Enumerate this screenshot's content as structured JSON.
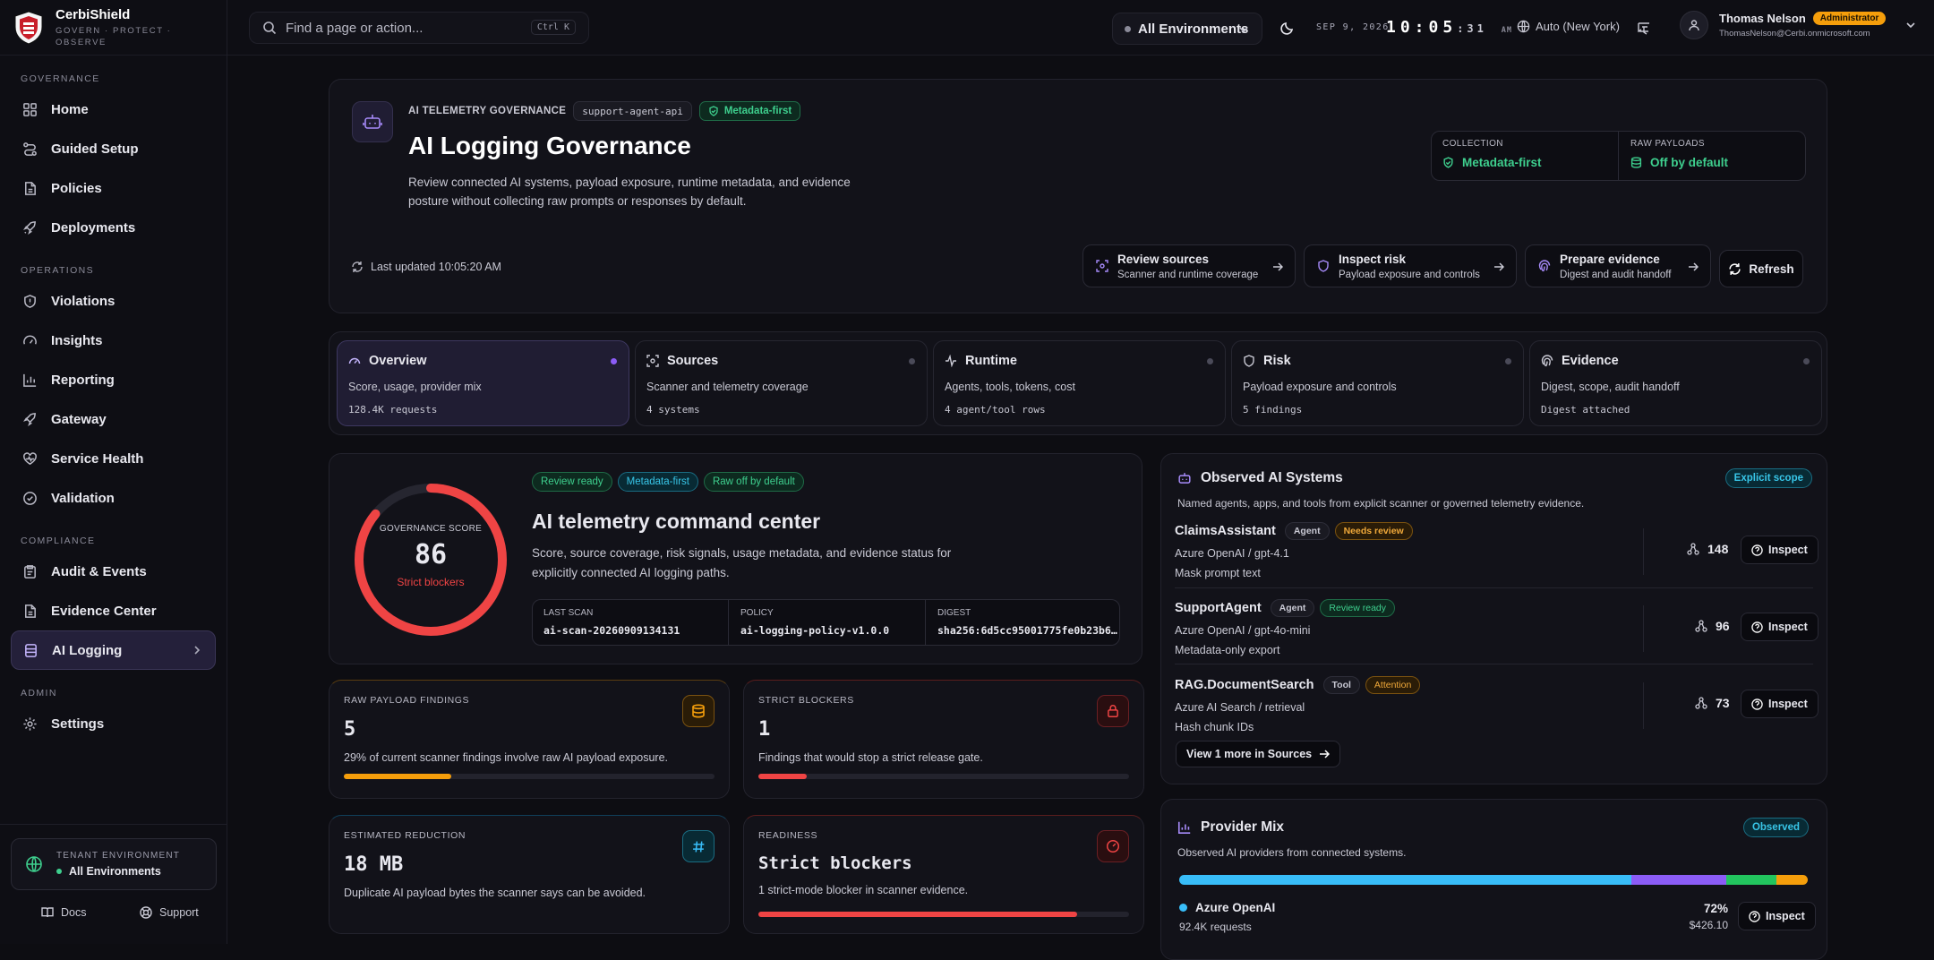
{
  "brand": {
    "name": "CerbiShield",
    "tagline_1": "GOVERN · PROTECT ·",
    "tagline_2": "OBSERVE"
  },
  "sidebar": {
    "sections": [
      {
        "title": "GOVERNANCE",
        "items": [
          "Home",
          "Guided Setup",
          "Policies",
          "Deployments"
        ]
      },
      {
        "title": "OPERATIONS",
        "items": [
          "Violations",
          "Insights",
          "Reporting",
          "Gateway",
          "Service Health",
          "Validation"
        ]
      },
      {
        "title": "COMPLIANCE",
        "items": [
          "Audit & Events",
          "Evidence Center",
          "AI Logging"
        ]
      },
      {
        "title": "ADMIN",
        "items": [
          "Settings"
        ]
      }
    ],
    "active": "AI Logging",
    "tenant": {
      "label": "TENANT ENVIRONMENT",
      "value": "All Environments"
    },
    "footer": {
      "docs": "Docs",
      "support": "Support"
    }
  },
  "topbar": {
    "search_placeholder": "Find a page or action...",
    "search_shortcut": "Ctrl K",
    "environment": "All Environments",
    "date": "SEP 9, 2026",
    "time_hm": "10:05",
    "time_s": ":31",
    "time_ampm": "AM",
    "timezone": "Auto (New York)",
    "user": {
      "name": "Thomas Nelson",
      "role": "Administrator",
      "email": "ThomasNelson@Cerbi.onmicrosoft.com"
    }
  },
  "header": {
    "eyebrow": "AI TELEMETRY GOVERNANCE",
    "service_chip": "support-agent-api",
    "mode_chip": "Metadata-first",
    "title": "AI Logging Governance",
    "description_1": "Review connected AI systems, payload exposure, runtime metadata, and evidence",
    "description_2": "posture without collecting raw prompts or responses by default.",
    "collection": {
      "label": "COLLECTION",
      "value": "Metadata-first"
    },
    "raw_payloads": {
      "label": "RAW PAYLOADS",
      "value": "Off by default"
    },
    "last_updated": "Last updated 10:05:20 AM",
    "actions": [
      {
        "title": "Review sources",
        "subtitle": "Scanner and runtime coverage"
      },
      {
        "title": "Inspect risk",
        "subtitle": "Payload exposure and controls"
      },
      {
        "title": "Prepare evidence",
        "subtitle": "Digest and audit handoff"
      }
    ],
    "refresh": "Refresh"
  },
  "tabs": [
    {
      "title": "Overview",
      "desc": "Score, usage, provider mix",
      "count": "128.4K requests"
    },
    {
      "title": "Sources",
      "desc": "Scanner and telemetry coverage",
      "count": "4 systems"
    },
    {
      "title": "Runtime",
      "desc": "Agents, tools, tokens, cost",
      "count": "4 agent/tool rows"
    },
    {
      "title": "Risk",
      "desc": "Payload exposure and controls",
      "count": "5 findings"
    },
    {
      "title": "Evidence",
      "desc": "Digest, scope, audit handoff",
      "count": "Digest attached"
    }
  ],
  "command_center": {
    "chips": [
      "Review ready",
      "Metadata-first",
      "Raw off by default"
    ],
    "score_label": "GOVERNANCE SCORE",
    "score": 86,
    "score_status": "Strict blockers",
    "title": "AI telemetry command center",
    "desc_1": "Score, source coverage, risk signals, usage metadata, and evidence status for",
    "desc_2": "explicitly connected AI logging paths.",
    "facts": [
      {
        "label": "LAST SCAN",
        "value": "ai-scan-20260909134131"
      },
      {
        "label": "POLICY",
        "value": "ai-logging-policy-v1.0.0"
      },
      {
        "label": "DIGEST",
        "value": "sha256:6d5cc95001775fe0b23b6…"
      }
    ]
  },
  "metrics": [
    {
      "label": "RAW PAYLOAD FINDINGS",
      "value": "5",
      "desc": "29% of current scanner findings involve raw AI payload exposure.",
      "progress": 0.29,
      "color": "#f59e0b"
    },
    {
      "label": "STRICT BLOCKERS",
      "value": "1",
      "desc": "Findings that would stop a strict release gate.",
      "progress": 0.13,
      "color": "#ef4444"
    },
    {
      "label": "ESTIMATED REDUCTION",
      "value": "18 MB",
      "desc": "Duplicate AI payload bytes the scanner says can be avoided.",
      "progress": 0,
      "color": "#38bdf8"
    },
    {
      "label": "READINESS",
      "value": "Strict blockers",
      "desc": "1 strict-mode blocker in scanner evidence.",
      "progress": 0.86,
      "color": "#ef4444"
    }
  ],
  "observed": {
    "title": "Observed AI Systems",
    "scope_chip": "Explicit scope",
    "subtitle": "Named agents, apps, and tools from explicit scanner or governed telemetry evidence.",
    "systems": [
      {
        "name": "ClaimsAssistant",
        "kind": "Agent",
        "status": "Needs review",
        "model": "Azure OpenAI / gpt-4.1",
        "note": "Mask prompt text",
        "count": "148"
      },
      {
        "name": "SupportAgent",
        "kind": "Agent",
        "status": "Review ready",
        "model": "Azure OpenAI / gpt-4o-mini",
        "note": "Metadata-only export",
        "count": "96"
      },
      {
        "name": "RAG.DocumentSearch",
        "kind": "Tool",
        "status": "Attention",
        "model": "Azure AI Search / retrieval",
        "note": "Hash chunk IDs",
        "count": "73"
      }
    ],
    "inspect": "Inspect",
    "more": "View 1 more in Sources"
  },
  "provider_mix": {
    "title": "Provider Mix",
    "chip": "Observed",
    "subtitle": "Observed AI providers from connected systems.",
    "segments": [
      {
        "share": 0.72,
        "color": "#38bdf8"
      },
      {
        "share": 0.15,
        "color": "#8b5cf6"
      },
      {
        "share": 0.08,
        "color": "#22c55e"
      },
      {
        "share": 0.05,
        "color": "#f59e0b"
      }
    ],
    "top": {
      "name": "Azure OpenAI",
      "requests": "92.4K requests",
      "share": "72%",
      "cost": "$426.10"
    }
  }
}
